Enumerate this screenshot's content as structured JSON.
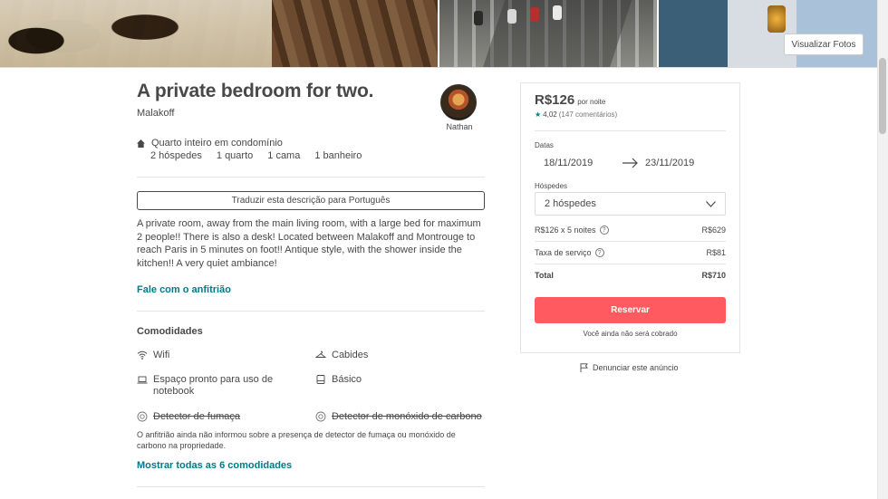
{
  "photos": {
    "view_button_label": "Visualizar Fotos"
  },
  "listing": {
    "title": "A private bedroom for two.",
    "location": "Malakoff",
    "room_type": "Quarto inteiro em condomínio",
    "stats": [
      "2 hóspedes",
      "1 quarto",
      "1 cama",
      "1 banheiro"
    ],
    "translate_button": "Traduzir esta descrição para Português",
    "description": "A private room, away from the main living room, with a large bed for maximum 2 people!! There is also a desk! Located between Malakoff and Montrouge to reach Paris in 5 minutes on foot!! Antique style, with the shower inside the kitchen!! A very quiet ambiance!",
    "contact_host": "Fale com o anfitrião"
  },
  "host": {
    "name": "Nathan"
  },
  "amenities": {
    "heading": "Comodidades",
    "items": [
      {
        "label": "Wifi",
        "icon": "wifi-icon",
        "unavailable": false
      },
      {
        "label": "Cabides",
        "icon": "hanger-icon",
        "unavailable": false
      },
      {
        "label": "Espaço pronto para uso de notebook",
        "icon": "laptop-icon",
        "unavailable": false
      },
      {
        "label": "Básico",
        "icon": "essentials-icon",
        "unavailable": false
      },
      {
        "label": "Detector de fumaça",
        "icon": "smoke-detector-icon",
        "unavailable": true
      },
      {
        "label": "Detector de monóxido de carbono",
        "icon": "co-detector-icon",
        "unavailable": true
      }
    ],
    "note": "O anfitrião ainda não informou sobre a presença de detector de fumaça ou monóxido de carbono na propriedade.",
    "show_all": "Mostrar todas as 6 comodidades"
  },
  "booking": {
    "price": "R$126",
    "per_night": "por noite",
    "rating": "4,02",
    "reviews": "(147 comentários)",
    "dates_label": "Datas",
    "check_in": "18/11/2019",
    "check_out": "23/11/2019",
    "guests_label": "Hóspedes",
    "guests_value": "2 hóspedes",
    "nightly_line_label": "R$126 x 5 noites",
    "nightly_line_value": "R$629",
    "service_fee_label": "Taxa de serviço",
    "service_fee_value": "R$81",
    "total_label": "Total",
    "total_value": "R$710",
    "reserve_button": "Reservar",
    "not_charged": "Você ainda não será cobrado"
  },
  "report": {
    "label": "Denunciar este anúncio"
  },
  "colors": {
    "accent": "#ff5a5f",
    "link": "#007a87",
    "text": "#484848",
    "star": "#008489"
  }
}
